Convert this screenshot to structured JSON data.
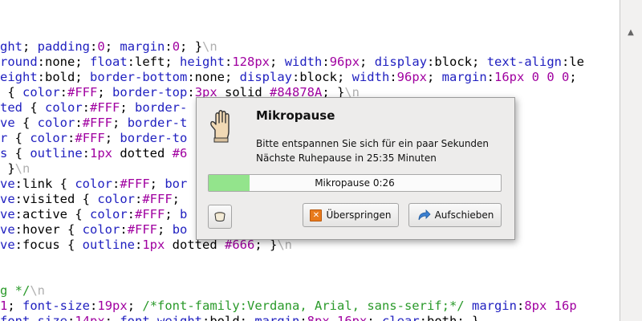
{
  "code_colors": {
    "default": "#000000",
    "keyword": "#2020c0",
    "number": "#a000a0",
    "comment": "#2a9a2a",
    "whitespace": "#b0b0b0"
  },
  "code_lines": [
    [
      {
        "t": "ght",
        "c": "#2020c0"
      },
      {
        "t": "; ",
        "c": "#000"
      },
      {
        "t": "padding",
        "c": "#2020c0"
      },
      {
        "t": ":",
        "c": "#000"
      },
      {
        "t": "0",
        "c": "#a000a0"
      },
      {
        "t": "; ",
        "c": "#000"
      },
      {
        "t": "margin",
        "c": "#2020c0"
      },
      {
        "t": ":",
        "c": "#000"
      },
      {
        "t": "0",
        "c": "#a000a0"
      },
      {
        "t": "; }",
        "c": "#000"
      },
      {
        "t": "\\n",
        "c": "#b0b0b0"
      }
    ],
    [
      {
        "t": "round",
        "c": "#2020c0"
      },
      {
        "t": ":none; ",
        "c": "#000"
      },
      {
        "t": "float",
        "c": "#2020c0"
      },
      {
        "t": ":left; ",
        "c": "#000"
      },
      {
        "t": "height",
        "c": "#2020c0"
      },
      {
        "t": ":",
        "c": "#000"
      },
      {
        "t": "128px",
        "c": "#a000a0"
      },
      {
        "t": "; ",
        "c": "#000"
      },
      {
        "t": "width",
        "c": "#2020c0"
      },
      {
        "t": ":",
        "c": "#000"
      },
      {
        "t": "96px",
        "c": "#a000a0"
      },
      {
        "t": "; ",
        "c": "#000"
      },
      {
        "t": "display",
        "c": "#2020c0"
      },
      {
        "t": ":block; ",
        "c": "#000"
      },
      {
        "t": "text-align",
        "c": "#2020c0"
      },
      {
        "t": ":le",
        "c": "#000"
      }
    ],
    [
      {
        "t": "eight",
        "c": "#2020c0"
      },
      {
        "t": ":bold; ",
        "c": "#000"
      },
      {
        "t": "border-bottom",
        "c": "#2020c0"
      },
      {
        "t": ":none; ",
        "c": "#000"
      },
      {
        "t": "display",
        "c": "#2020c0"
      },
      {
        "t": ":block; ",
        "c": "#000"
      },
      {
        "t": "width",
        "c": "#2020c0"
      },
      {
        "t": ":",
        "c": "#000"
      },
      {
        "t": "96px",
        "c": "#a000a0"
      },
      {
        "t": "; ",
        "c": "#000"
      },
      {
        "t": "margin",
        "c": "#2020c0"
      },
      {
        "t": ":",
        "c": "#000"
      },
      {
        "t": "16px 0 0 0",
        "c": "#a000a0"
      },
      {
        "t": ";",
        "c": "#000"
      }
    ],
    [
      {
        "t": " { ",
        "c": "#000"
      },
      {
        "t": "color",
        "c": "#2020c0"
      },
      {
        "t": ":",
        "c": "#000"
      },
      {
        "t": "#FFF",
        "c": "#a000a0"
      },
      {
        "t": "; ",
        "c": "#000"
      },
      {
        "t": "border-top",
        "c": "#2020c0"
      },
      {
        "t": ":",
        "c": "#000"
      },
      {
        "t": "3px",
        "c": "#a000a0"
      },
      {
        "t": " solid ",
        "c": "#000"
      },
      {
        "t": "#84878A",
        "c": "#a000a0"
      },
      {
        "t": "; }",
        "c": "#000"
      },
      {
        "t": "\\n",
        "c": "#b0b0b0"
      }
    ],
    [
      {
        "t": "ted",
        "c": "#2020c0"
      },
      {
        "t": " { ",
        "c": "#000"
      },
      {
        "t": "color",
        "c": "#2020c0"
      },
      {
        "t": ":",
        "c": "#000"
      },
      {
        "t": "#FFF",
        "c": "#a000a0"
      },
      {
        "t": "; ",
        "c": "#000"
      },
      {
        "t": "border-",
        "c": "#2020c0"
      }
    ],
    [
      {
        "t": "ve",
        "c": "#2020c0"
      },
      {
        "t": " { ",
        "c": "#000"
      },
      {
        "t": "color",
        "c": "#2020c0"
      },
      {
        "t": ":",
        "c": "#000"
      },
      {
        "t": "#FFF",
        "c": "#a000a0"
      },
      {
        "t": "; ",
        "c": "#000"
      },
      {
        "t": "border-t",
        "c": "#2020c0"
      }
    ],
    [
      {
        "t": "r",
        "c": "#2020c0"
      },
      {
        "t": " { ",
        "c": "#000"
      },
      {
        "t": "color",
        "c": "#2020c0"
      },
      {
        "t": ":",
        "c": "#000"
      },
      {
        "t": "#FFF",
        "c": "#a000a0"
      },
      {
        "t": "; ",
        "c": "#000"
      },
      {
        "t": "border-to",
        "c": "#2020c0"
      }
    ],
    [
      {
        "t": "s",
        "c": "#2020c0"
      },
      {
        "t": " { ",
        "c": "#000"
      },
      {
        "t": "outline",
        "c": "#2020c0"
      },
      {
        "t": ":",
        "c": "#000"
      },
      {
        "t": "1px",
        "c": "#a000a0"
      },
      {
        "t": " dotted ",
        "c": "#000"
      },
      {
        "t": "#6",
        "c": "#a000a0"
      }
    ],
    [
      {
        "t": " }",
        "c": "#000"
      },
      {
        "t": "\\n",
        "c": "#b0b0b0"
      }
    ],
    [
      {
        "t": "ve",
        "c": "#2020c0"
      },
      {
        "t": ":link { ",
        "c": "#000"
      },
      {
        "t": "color",
        "c": "#2020c0"
      },
      {
        "t": ":",
        "c": "#000"
      },
      {
        "t": "#FFF",
        "c": "#a000a0"
      },
      {
        "t": "; ",
        "c": "#000"
      },
      {
        "t": "bor",
        "c": "#2020c0"
      }
    ],
    [
      {
        "t": "ve",
        "c": "#2020c0"
      },
      {
        "t": ":visited { ",
        "c": "#000"
      },
      {
        "t": "color",
        "c": "#2020c0"
      },
      {
        "t": ":",
        "c": "#000"
      },
      {
        "t": "#FFF",
        "c": "#a000a0"
      },
      {
        "t": ";",
        "c": "#000"
      }
    ],
    [
      {
        "t": "ve",
        "c": "#2020c0"
      },
      {
        "t": ":active { ",
        "c": "#000"
      },
      {
        "t": "color",
        "c": "#2020c0"
      },
      {
        "t": ":",
        "c": "#000"
      },
      {
        "t": "#FFF",
        "c": "#a000a0"
      },
      {
        "t": "; ",
        "c": "#000"
      },
      {
        "t": "b",
        "c": "#2020c0"
      }
    ],
    [
      {
        "t": "ve",
        "c": "#2020c0"
      },
      {
        "t": ":hover { ",
        "c": "#000"
      },
      {
        "t": "color",
        "c": "#2020c0"
      },
      {
        "t": ":",
        "c": "#000"
      },
      {
        "t": "#FFF",
        "c": "#a000a0"
      },
      {
        "t": "; ",
        "c": "#000"
      },
      {
        "t": "bo",
        "c": "#2020c0"
      }
    ],
    [
      {
        "t": "ve",
        "c": "#2020c0"
      },
      {
        "t": ":focus { ",
        "c": "#000"
      },
      {
        "t": "outline",
        "c": "#2020c0"
      },
      {
        "t": ":",
        "c": "#000"
      },
      {
        "t": "1px",
        "c": "#a000a0"
      },
      {
        "t": " dotted ",
        "c": "#000"
      },
      {
        "t": "#666",
        "c": "#a000a0"
      },
      {
        "t": "; }",
        "c": "#000"
      },
      {
        "t": "\\n",
        "c": "#b0b0b0"
      }
    ],
    [],
    [],
    [
      {
        "t": "g */",
        "c": "#2a9a2a"
      },
      {
        "t": "\\n",
        "c": "#b0b0b0"
      }
    ],
    [
      {
        "t": "1",
        "c": "#a000a0"
      },
      {
        "t": "; ",
        "c": "#000"
      },
      {
        "t": "font-size",
        "c": "#2020c0"
      },
      {
        "t": ":",
        "c": "#000"
      },
      {
        "t": "19px",
        "c": "#a000a0"
      },
      {
        "t": "; ",
        "c": "#000"
      },
      {
        "t": "/*font-family:Verdana, Arial, sans-serif;*/",
        "c": "#2a9a2a"
      },
      {
        "t": " ",
        "c": "#000"
      },
      {
        "t": "margin",
        "c": "#2020c0"
      },
      {
        "t": ":",
        "c": "#000"
      },
      {
        "t": "8px 16p",
        "c": "#a000a0"
      }
    ],
    [
      {
        "t": "font-size",
        "c": "#2020c0"
      },
      {
        "t": ":",
        "c": "#000"
      },
      {
        "t": "14px",
        "c": "#a000a0"
      },
      {
        "t": "; ",
        "c": "#000"
      },
      {
        "t": "font-weight",
        "c": "#2020c0"
      },
      {
        "t": ":bold; ",
        "c": "#000"
      },
      {
        "t": "margin",
        "c": "#2020c0"
      },
      {
        "t": ":",
        "c": "#000"
      },
      {
        "t": "8px 16px",
        "c": "#a000a0"
      },
      {
        "t": "; ",
        "c": "#000"
      },
      {
        "t": "clear",
        "c": "#2020c0"
      },
      {
        "t": ":both; }",
        "c": "#000"
      }
    ]
  ],
  "dialog": {
    "title": "Mikropause",
    "message": "Bitte entspannen Sie sich für ein paar Sekunden",
    "next_break": "Nächste Ruhepause in 25:35 Minuten",
    "progress_label": "Mikropause 0:26",
    "progress_fraction": 0.14,
    "skip_label": "Überspringen",
    "postpone_label": "Aufschieben",
    "icons": {
      "hand": "hand-icon",
      "small": "coffee-cup-icon",
      "skip": "skip-icon",
      "postpone": "postpone-arrow-icon"
    }
  },
  "scrollbar": {
    "arrow": "scroll-up-arrow-icon"
  }
}
